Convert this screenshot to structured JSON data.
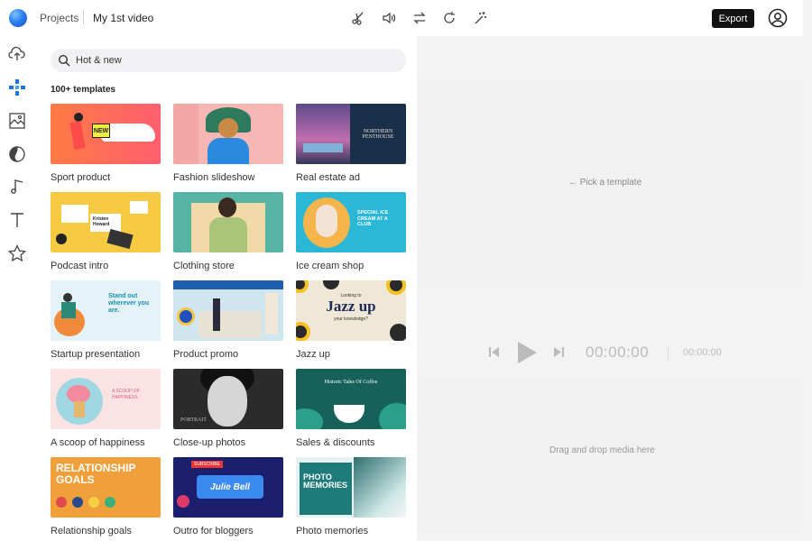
{
  "header": {
    "breadcrumb_projects": "Projects",
    "project_title": "My 1st video",
    "export_label": "Export",
    "tools": [
      "scissors-icon",
      "volume-icon",
      "swap-icon",
      "rotate-icon",
      "magic-wand-icon"
    ]
  },
  "sidebar": {
    "items": [
      "upload-icon",
      "templates-icon",
      "media-icon",
      "elements-icon",
      "music-icon",
      "text-icon",
      "star-icon"
    ]
  },
  "panel": {
    "search_value": "Hot & new",
    "templates_count": "100+ templates",
    "templates": [
      {
        "label": "Sport product"
      },
      {
        "label": "Fashion slideshow"
      },
      {
        "label": "Real estate ad"
      },
      {
        "label": "Podcast intro"
      },
      {
        "label": "Clothing store"
      },
      {
        "label": "Ice cream shop"
      },
      {
        "label": "Startup presentation"
      },
      {
        "label": "Product promo"
      },
      {
        "label": "Jazz up"
      },
      {
        "label": "A scoop of happiness"
      },
      {
        "label": "Close-up photos"
      },
      {
        "label": "Sales & discounts"
      },
      {
        "label": "Relationship goals"
      },
      {
        "label": "Outro for bloggers"
      },
      {
        "label": "Photo memories"
      }
    ],
    "thumb_text": {
      "sport_badge": "NEW",
      "realestate": "NORTHERN PENTHOUSE",
      "podcast_name": "Kristen Howard",
      "icecream": "SPECIAL ICE CREAM AT A CLUB",
      "startup": "Stand out wherever you are.",
      "jazz_small": "Looking to",
      "jazz_big": "Jazz up",
      "jazz_sub": "your knowledge?",
      "scoop": "A SCOOP OF HAPPINESS",
      "closeup": "PORTRAIT",
      "sales": "Historic Tales Of Coffee",
      "relationship": "RELATIONSHIP GOALS",
      "outro_small": "SUBSCRIBE",
      "outro": "Julie Bell",
      "photo": "PHOTO MEMORIES"
    }
  },
  "preview": {
    "hint": "← Pick a template",
    "time_current": "00:00:00",
    "time_total": "00:00:00",
    "drop_hint": "Drag and drop media here"
  }
}
